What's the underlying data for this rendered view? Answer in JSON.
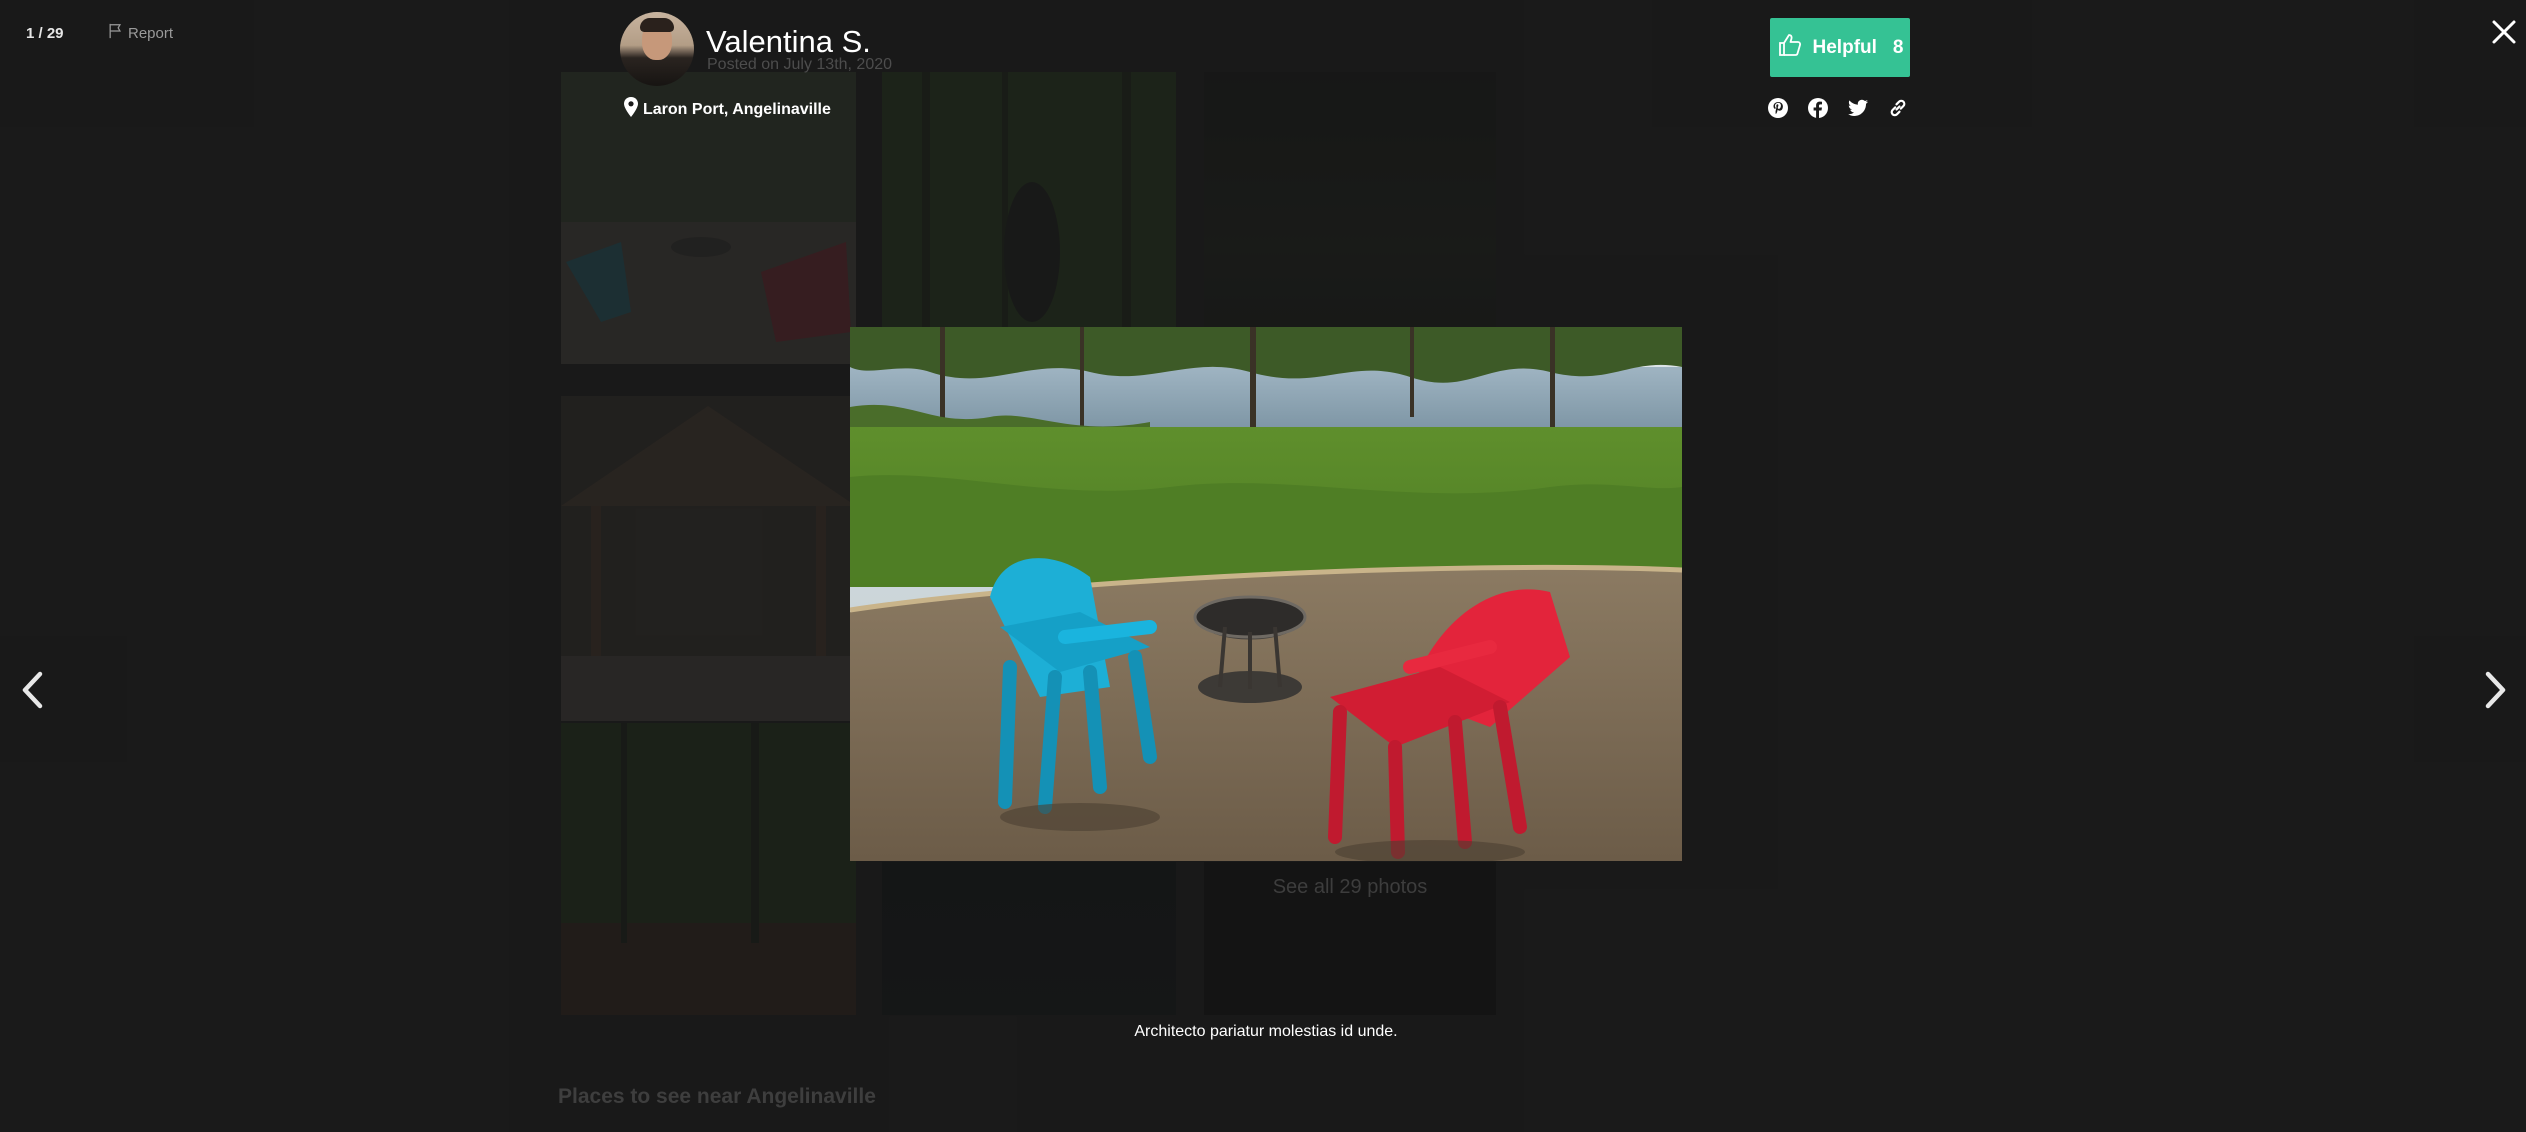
{
  "viewer": {
    "counter": "1 / 29",
    "report_label": "Report",
    "caption": "Architecto pariatur molestias id unde."
  },
  "author": {
    "name": "Valentina S.",
    "posted": "Posted on July 13th, 2020",
    "location": "Laron Port, Angelinaville"
  },
  "helpful": {
    "label": "Helpful",
    "count": "8"
  },
  "background_page": {
    "see_all": "See all 29 photos",
    "places_heading": "Places to see near Angelinaville"
  },
  "icons": {
    "report": "flag-icon",
    "location": "map-pin-icon",
    "helpful": "thumbs-up-icon",
    "share": [
      "pinterest-icon",
      "facebook-icon",
      "twitter-icon",
      "link-icon"
    ],
    "close": "close-icon",
    "prev": "chevron-left-icon",
    "next": "chevron-right-icon"
  },
  "colors": {
    "background": "#1a1a1a",
    "helpful_accent": "#35c294"
  }
}
